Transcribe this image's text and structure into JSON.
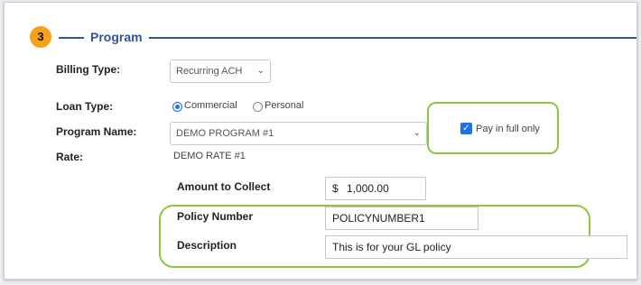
{
  "section": {
    "step_number": "3",
    "title": "Program"
  },
  "form": {
    "billing_type": {
      "label": "Billing Type:",
      "value": "Recurring ACH"
    },
    "loan_type": {
      "label": "Loan Type:",
      "options": [
        "Commercial",
        "Personal"
      ],
      "selected": "Commercial"
    },
    "program_name": {
      "label": "Program Name:",
      "value": "DEMO PROGRAM #1"
    },
    "pay_in_full": {
      "label": "Pay in full only",
      "checked": true
    },
    "rate": {
      "label": "Rate:",
      "value": "DEMO RATE #1"
    },
    "amount_to_collect": {
      "label": "Amount to Collect",
      "currency": "$",
      "value": "1,000.00"
    },
    "policy_number": {
      "label": "Policy Number",
      "value": "POLICYNUMBER1"
    },
    "description": {
      "label": "Description",
      "value": "This is for your GL policy"
    }
  },
  "colors": {
    "accent_blue": "#2f5597",
    "step_badge": "#f5a21b",
    "highlight_green": "#8cc63f",
    "control_blue": "#1a73e8"
  }
}
